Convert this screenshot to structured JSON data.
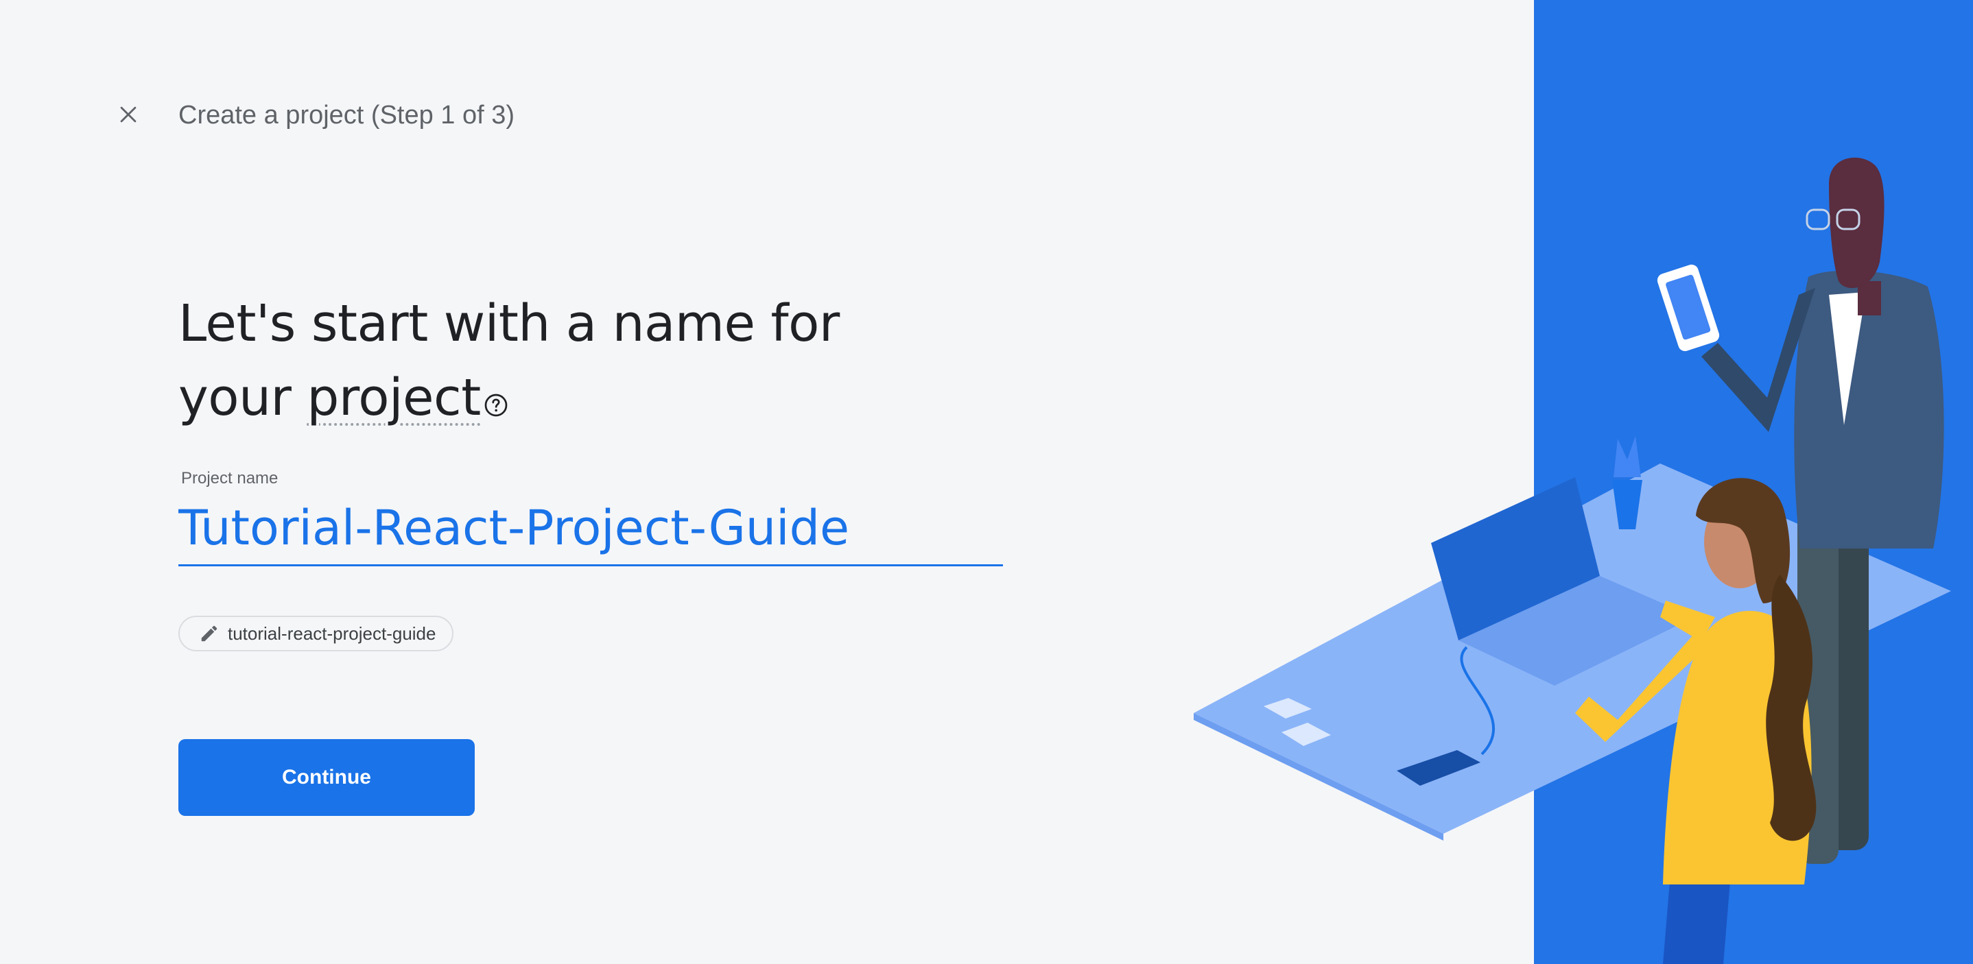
{
  "header": {
    "close_icon": "close-icon",
    "title": "Create a project (Step 1 of 3)"
  },
  "main": {
    "headline_line1": "Let's start with a name for",
    "headline_prefix": "your ",
    "headline_term": "project",
    "help_icon": "help-circle-icon",
    "field_label": "Project name",
    "project_name_value": "Tutorial-React-Project-Guide",
    "project_id": "tutorial-react-project-guide",
    "edit_icon": "pencil-icon",
    "continue_label": "Continue"
  },
  "colors": {
    "accent": "#1a73e8",
    "panel_blue": "#2374e6",
    "background": "#f5f6f8"
  }
}
